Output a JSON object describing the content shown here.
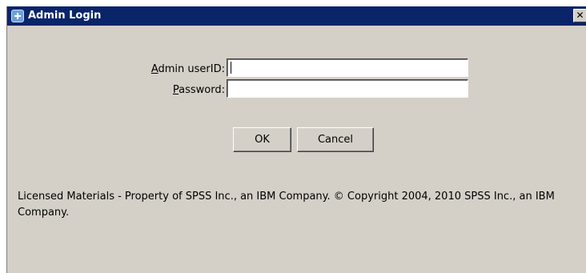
{
  "window": {
    "title": "Admin Login",
    "close_glyph": "✕"
  },
  "form": {
    "userid_label_mnemonic": "A",
    "userid_label_rest": "dmin userID:",
    "userid_value": "",
    "password_label_mnemonic": "P",
    "password_label_rest": "assword:",
    "password_value": ""
  },
  "buttons": {
    "ok_label": "OK",
    "cancel_label": "Cancel"
  },
  "footer": {
    "license_text": "Licensed Materials - Property of SPSS Inc., an IBM Company. © Copyright 2004, 2010 SPSS Inc., an IBM Company."
  },
  "colors": {
    "titlebar": "#0a246a",
    "dialog_bg": "#d4d0c8"
  },
  "icons": {
    "title": "app-icon",
    "close": "close-icon"
  }
}
